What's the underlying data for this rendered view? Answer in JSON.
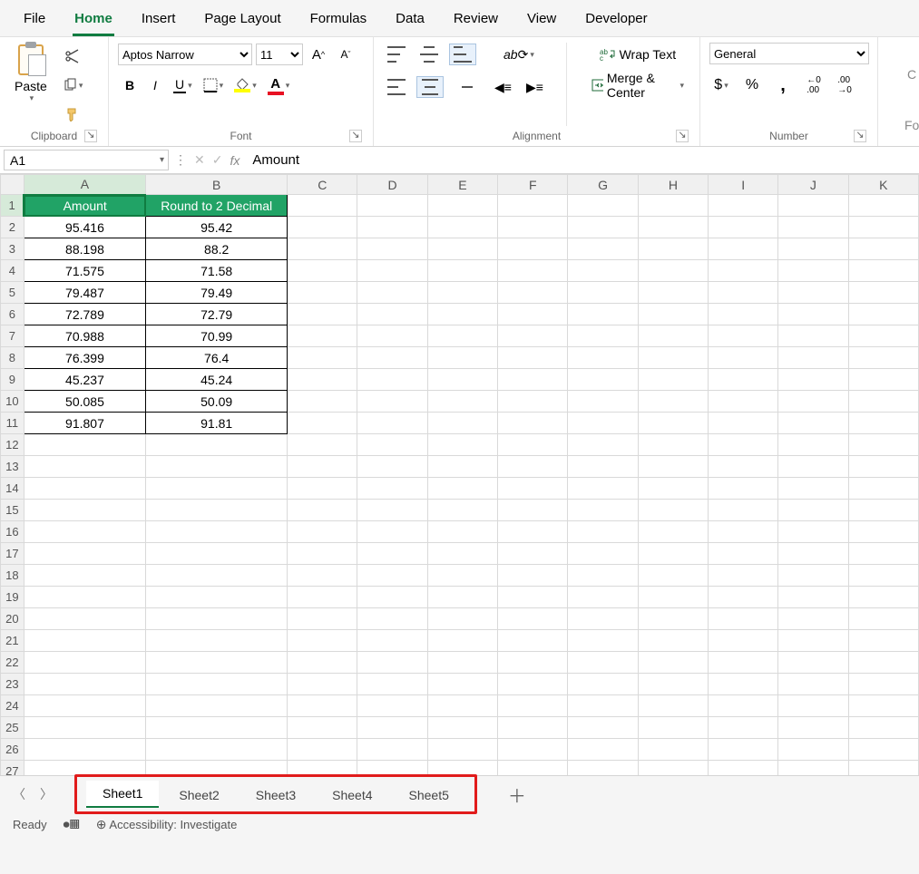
{
  "menu": {
    "tabs": [
      "File",
      "Home",
      "Insert",
      "Page Layout",
      "Formulas",
      "Data",
      "Review",
      "View",
      "Developer"
    ],
    "active": 1
  },
  "ribbon": {
    "clipboard": {
      "paste": "Paste",
      "label": "Clipboard"
    },
    "font": {
      "name": "Aptos Narrow",
      "size": "11",
      "bold": "B",
      "italic": "I",
      "underline": "U",
      "label": "Font"
    },
    "alignment": {
      "wrap": "Wrap Text",
      "merge": "Merge & Center",
      "label": "Alignment"
    },
    "number": {
      "format": "General",
      "label": "Number"
    }
  },
  "formula_bar": {
    "name_box": "A1",
    "fx": "fx",
    "value": "Amount"
  },
  "grid": {
    "cols": [
      "A",
      "B",
      "C",
      "D",
      "E",
      "F",
      "G",
      "H",
      "I",
      "J",
      "K"
    ],
    "col_widths": {
      "A": 138,
      "B": 160
    },
    "row_count": 27,
    "headers": {
      "A": "Amount",
      "B": "Round to 2 Decimal"
    },
    "data": [
      {
        "A": "95.416",
        "B": "95.42"
      },
      {
        "A": "88.198",
        "B": "88.2"
      },
      {
        "A": "71.575",
        "B": "71.58"
      },
      {
        "A": "79.487",
        "B": "79.49"
      },
      {
        "A": "72.789",
        "B": "72.79"
      },
      {
        "A": "70.988",
        "B": "70.99"
      },
      {
        "A": "76.399",
        "B": "76.4"
      },
      {
        "A": "45.237",
        "B": "45.24"
      },
      {
        "A": "50.085",
        "B": "50.09"
      },
      {
        "A": "91.807",
        "B": "91.81"
      }
    ],
    "selected": "A1"
  },
  "sheets": {
    "tabs": [
      "Sheet1",
      "Sheet2",
      "Sheet3",
      "Sheet4",
      "Sheet5"
    ],
    "active": 0
  },
  "status": {
    "ready": "Ready",
    "accessibility": "Accessibility: Investigate"
  },
  "cutoff": {
    "c": "C",
    "fo": "Fo"
  }
}
